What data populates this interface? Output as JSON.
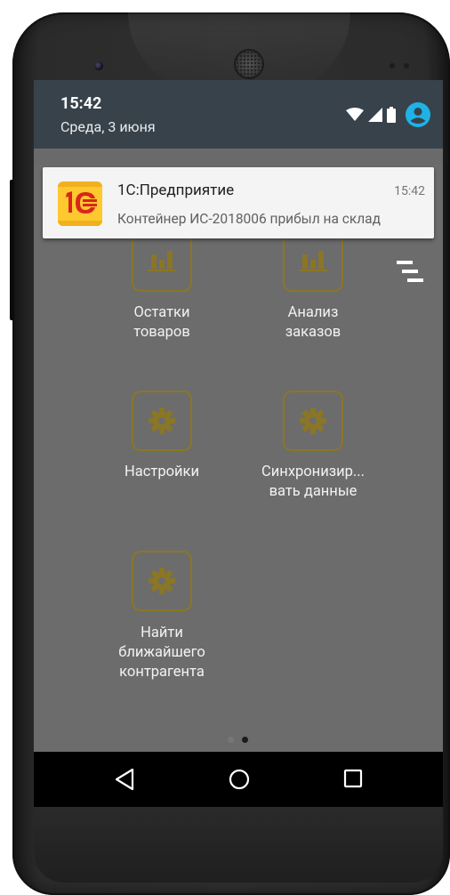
{
  "status_bar": {
    "time": "15:42",
    "date": "Среда, 3 июня"
  },
  "notification": {
    "app_name": "1С:Предприятие",
    "time": "15:42",
    "message": "Контейнер ИС-2018006 прибыл на склад"
  },
  "tiles": [
    {
      "label": "Остатки\nтоваров",
      "icon": "bar-chart-icon"
    },
    {
      "label": "Анализ\nзаказов",
      "icon": "bar-chart-icon"
    },
    {
      "label": "Настройки",
      "icon": "gear-icon"
    },
    {
      "label": "Синхронизир...\nвать данные",
      "icon": "gear-icon"
    },
    {
      "label": "Найти\nближайшего\nконтрагента",
      "icon": "gear-icon"
    }
  ],
  "pager": {
    "pages": 2,
    "active_page": 2
  },
  "nav_bar": {
    "buttons": [
      "back-icon",
      "home-icon",
      "recents-icon"
    ]
  },
  "colors": {
    "accent": "#fec82f",
    "tile_icon": "#8a7625",
    "status_shade": "#38424a",
    "profile_icon": "#1fb2e6"
  }
}
